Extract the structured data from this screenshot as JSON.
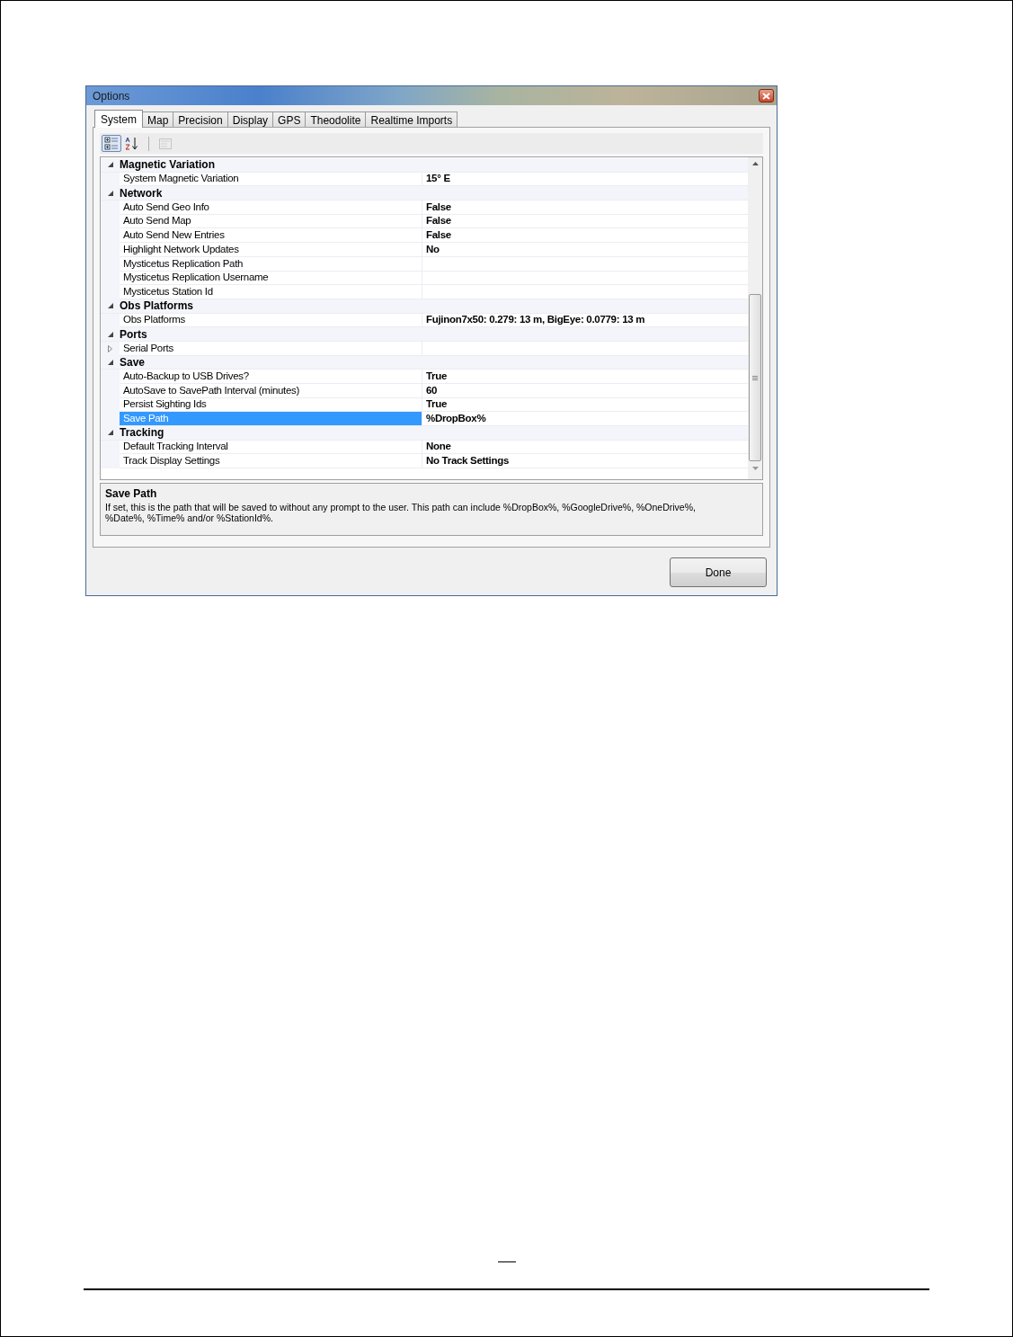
{
  "window": {
    "title": "Options"
  },
  "tabs": [
    {
      "label": "System",
      "selected": true
    },
    {
      "label": "Map",
      "selected": false
    },
    {
      "label": "Precision",
      "selected": false
    },
    {
      "label": "Display",
      "selected": false
    },
    {
      "label": "GPS",
      "selected": false
    },
    {
      "label": "Theodolite",
      "selected": false
    },
    {
      "label": "Realtime Imports",
      "selected": false
    }
  ],
  "toolbar": [
    {
      "kind": "categorized",
      "selected": true,
      "disabled": false
    },
    {
      "kind": "alphabetical",
      "selected": false,
      "disabled": false
    },
    {
      "kind": "property_pages",
      "selected": false,
      "disabled": true
    }
  ],
  "categories": [
    {
      "name": "Magnetic Variation",
      "expanded": true,
      "properties": [
        {
          "kind": "plain",
          "name": "System Magnetic Variation",
          "value": "15° E",
          "selected": false
        }
      ]
    },
    {
      "name": "Network",
      "expanded": true,
      "properties": [
        {
          "kind": "plain",
          "name": "Auto Send Geo Info",
          "value": "False",
          "selected": false
        },
        {
          "kind": "plain",
          "name": "Auto Send Map",
          "value": "False",
          "selected": false
        },
        {
          "kind": "plain",
          "name": "Auto Send New Entries",
          "value": "False",
          "selected": false
        },
        {
          "kind": "plain",
          "name": "Highlight Network Updates",
          "value": "No",
          "selected": false
        },
        {
          "kind": "plain",
          "name": "Mysticetus Replication Path",
          "selected": false
        },
        {
          "kind": "plain",
          "name": "Mysticetus Replication Username",
          "selected": false
        },
        {
          "kind": "plain",
          "name": "Mysticetus Station Id",
          "selected": false
        }
      ]
    },
    {
      "name": "Obs Platforms",
      "expanded": true,
      "properties": [
        {
          "kind": "plain",
          "name": "Obs Platforms",
          "value": "Fujinon7x50: 0.279: 13 m, BigEye: 0.0779: 13 m",
          "selected": false
        }
      ]
    },
    {
      "name": "Ports",
      "expanded": true,
      "properties": [
        {
          "kind": "expandable",
          "name": "Serial Ports",
          "expanded": false,
          "selected": false
        }
      ]
    },
    {
      "name": "Save",
      "expanded": true,
      "properties": [
        {
          "kind": "plain",
          "name": "Auto-Backup to USB Drives?",
          "value": "True",
          "selected": false
        },
        {
          "kind": "plain",
          "name": "AutoSave to SavePath Interval (minutes)",
          "value": "60",
          "selected": false
        },
        {
          "kind": "plain",
          "name": "Persist Sighting Ids",
          "value": "True",
          "selected": false
        },
        {
          "kind": "plain",
          "name": "Save Path",
          "value": "%DropBox%",
          "selected": true
        }
      ]
    },
    {
      "name": "Tracking",
      "expanded": true,
      "properties": [
        {
          "kind": "plain",
          "name": "Default Tracking Interval",
          "value": "None",
          "selected": false
        },
        {
          "kind": "plain",
          "name": "Track Display Settings",
          "value": "No Track Settings",
          "selected": false
        }
      ]
    }
  ],
  "description": {
    "title": "Save Path",
    "text": "If set, this is the path that will be saved to without any prompt to the user. This path can include %DropBox%, %GoogleDrive%, %OneDrive%, %Date%, %Time% and/or %StationId%."
  },
  "buttons": [
    {
      "label": "Done"
    }
  ]
}
